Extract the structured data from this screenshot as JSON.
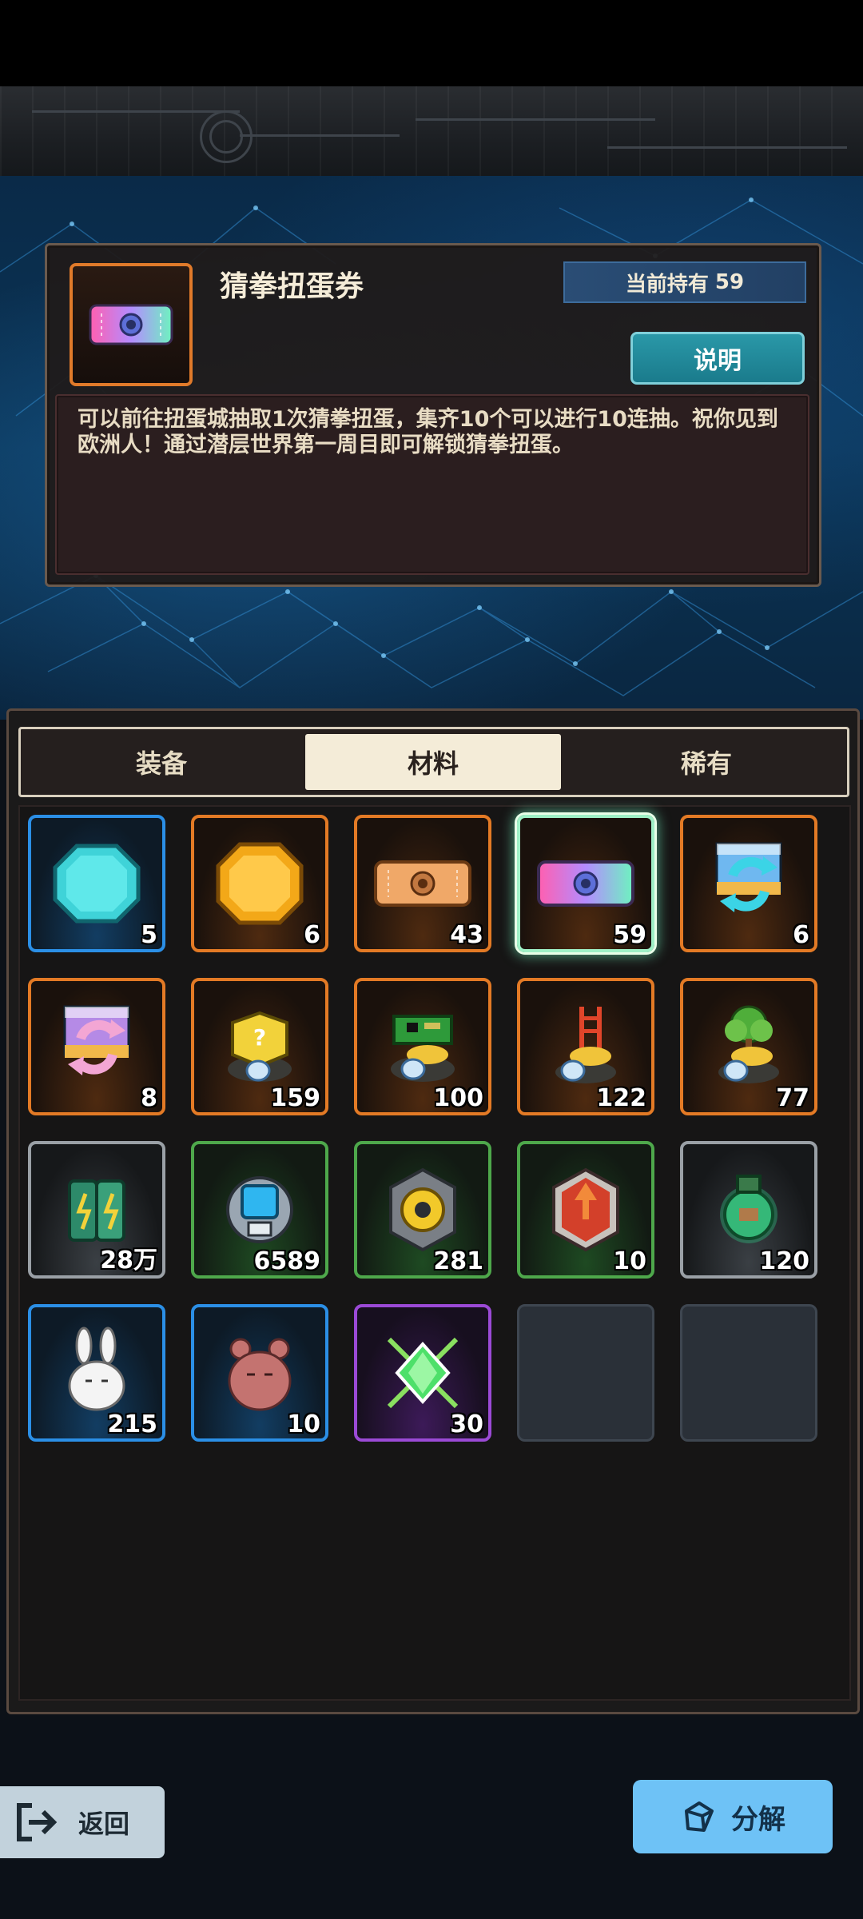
{
  "item_detail": {
    "name": "猜拳扭蛋券",
    "held_label": "当前持有",
    "held_count": "59",
    "explain_button": "说明",
    "description": "可以前往扭蛋城抽取1次猜拳扭蛋，集齐10个可以进行10连抽。祝你见到欧洲人！通过潜层世界第一周目即可解锁猜拳扭蛋。"
  },
  "tabs": [
    {
      "label": "装备",
      "active": false
    },
    {
      "label": "材料",
      "active": true
    },
    {
      "label": "稀有",
      "active": false
    }
  ],
  "items": [
    {
      "icon": "cyan-octagon-coin-icon",
      "rarity": "blue",
      "qty": "5"
    },
    {
      "icon": "gold-coin-icon",
      "rarity": "orange",
      "qty": "6"
    },
    {
      "icon": "orange-ticket-icon",
      "rarity": "orange",
      "qty": "43"
    },
    {
      "icon": "rainbow-gacha-ticket-icon",
      "rarity": "orange",
      "qty": "59",
      "selected": true
    },
    {
      "icon": "blue-recycle-crate-icon",
      "rarity": "orange",
      "qty": "6"
    },
    {
      "icon": "pink-recycle-crate-icon",
      "rarity": "orange",
      "qty": "8"
    },
    {
      "icon": "mystery-box-egg-icon",
      "rarity": "orange",
      "qty": "159"
    },
    {
      "icon": "circuit-board-egg-icon",
      "rarity": "orange",
      "qty": "100"
    },
    {
      "icon": "ladder-egg-icon",
      "rarity": "orange",
      "qty": "122"
    },
    {
      "icon": "tree-egg-icon",
      "rarity": "orange",
      "qty": "77"
    },
    {
      "icon": "battery-cells-icon",
      "rarity": "gray",
      "qty": "28万"
    },
    {
      "icon": "robot-core-icon",
      "rarity": "green",
      "qty": "6589"
    },
    {
      "icon": "yellow-gear-chip-icon",
      "rarity": "green",
      "qty": "281"
    },
    {
      "icon": "red-arrow-chip-icon",
      "rarity": "green",
      "qty": "10"
    },
    {
      "icon": "green-potion-bottle-icon",
      "rarity": "gray",
      "qty": "120"
    },
    {
      "icon": "white-bunny-icon",
      "rarity": "blue",
      "qty": "215"
    },
    {
      "icon": "pink-bear-icon",
      "rarity": "blue",
      "qty": "10"
    },
    {
      "icon": "green-gem-icon",
      "rarity": "purple",
      "qty": "30"
    },
    {
      "icon": "",
      "rarity": "empty",
      "qty": ""
    },
    {
      "icon": "",
      "rarity": "empty",
      "qty": ""
    }
  ],
  "bottom": {
    "back_label": "返回",
    "decompose_label": "分解"
  },
  "colors": {
    "rarity_blue": "#2b8fe6",
    "rarity_orange": "#e37a25",
    "rarity_green": "#4ea84b",
    "rarity_gray": "#9aa0a6",
    "rarity_purple": "#9b4ad6",
    "accent_teal": "#1a7b8c",
    "decompose_blue": "#6ec2f6"
  }
}
